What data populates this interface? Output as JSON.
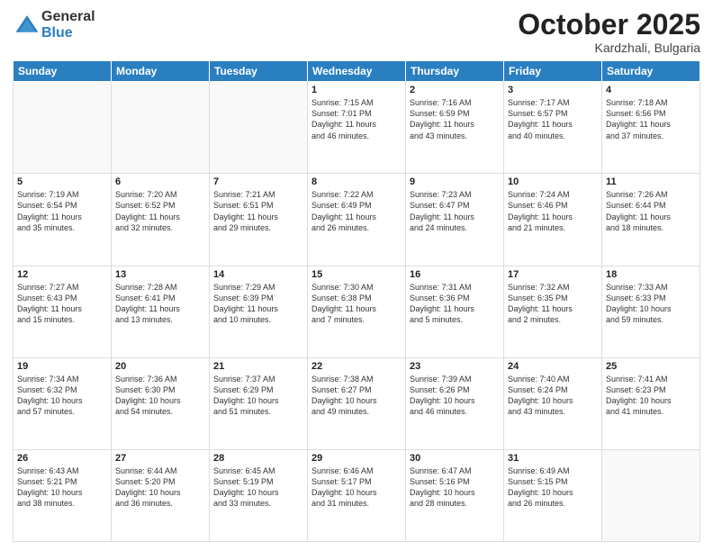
{
  "logo": {
    "general": "General",
    "blue": "Blue"
  },
  "header": {
    "month": "October 2025",
    "location": "Kardzhali, Bulgaria"
  },
  "weekdays": [
    "Sunday",
    "Monday",
    "Tuesday",
    "Wednesday",
    "Thursday",
    "Friday",
    "Saturday"
  ],
  "weeks": [
    [
      {
        "day": "",
        "info": ""
      },
      {
        "day": "",
        "info": ""
      },
      {
        "day": "",
        "info": ""
      },
      {
        "day": "1",
        "info": "Sunrise: 7:15 AM\nSunset: 7:01 PM\nDaylight: 11 hours\nand 46 minutes."
      },
      {
        "day": "2",
        "info": "Sunrise: 7:16 AM\nSunset: 6:59 PM\nDaylight: 11 hours\nand 43 minutes."
      },
      {
        "day": "3",
        "info": "Sunrise: 7:17 AM\nSunset: 6:57 PM\nDaylight: 11 hours\nand 40 minutes."
      },
      {
        "day": "4",
        "info": "Sunrise: 7:18 AM\nSunset: 6:56 PM\nDaylight: 11 hours\nand 37 minutes."
      }
    ],
    [
      {
        "day": "5",
        "info": "Sunrise: 7:19 AM\nSunset: 6:54 PM\nDaylight: 11 hours\nand 35 minutes."
      },
      {
        "day": "6",
        "info": "Sunrise: 7:20 AM\nSunset: 6:52 PM\nDaylight: 11 hours\nand 32 minutes."
      },
      {
        "day": "7",
        "info": "Sunrise: 7:21 AM\nSunset: 6:51 PM\nDaylight: 11 hours\nand 29 minutes."
      },
      {
        "day": "8",
        "info": "Sunrise: 7:22 AM\nSunset: 6:49 PM\nDaylight: 11 hours\nand 26 minutes."
      },
      {
        "day": "9",
        "info": "Sunrise: 7:23 AM\nSunset: 6:47 PM\nDaylight: 11 hours\nand 24 minutes."
      },
      {
        "day": "10",
        "info": "Sunrise: 7:24 AM\nSunset: 6:46 PM\nDaylight: 11 hours\nand 21 minutes."
      },
      {
        "day": "11",
        "info": "Sunrise: 7:26 AM\nSunset: 6:44 PM\nDaylight: 11 hours\nand 18 minutes."
      }
    ],
    [
      {
        "day": "12",
        "info": "Sunrise: 7:27 AM\nSunset: 6:43 PM\nDaylight: 11 hours\nand 15 minutes."
      },
      {
        "day": "13",
        "info": "Sunrise: 7:28 AM\nSunset: 6:41 PM\nDaylight: 11 hours\nand 13 minutes."
      },
      {
        "day": "14",
        "info": "Sunrise: 7:29 AM\nSunset: 6:39 PM\nDaylight: 11 hours\nand 10 minutes."
      },
      {
        "day": "15",
        "info": "Sunrise: 7:30 AM\nSunset: 6:38 PM\nDaylight: 11 hours\nand 7 minutes."
      },
      {
        "day": "16",
        "info": "Sunrise: 7:31 AM\nSunset: 6:36 PM\nDaylight: 11 hours\nand 5 minutes."
      },
      {
        "day": "17",
        "info": "Sunrise: 7:32 AM\nSunset: 6:35 PM\nDaylight: 11 hours\nand 2 minutes."
      },
      {
        "day": "18",
        "info": "Sunrise: 7:33 AM\nSunset: 6:33 PM\nDaylight: 10 hours\nand 59 minutes."
      }
    ],
    [
      {
        "day": "19",
        "info": "Sunrise: 7:34 AM\nSunset: 6:32 PM\nDaylight: 10 hours\nand 57 minutes."
      },
      {
        "day": "20",
        "info": "Sunrise: 7:36 AM\nSunset: 6:30 PM\nDaylight: 10 hours\nand 54 minutes."
      },
      {
        "day": "21",
        "info": "Sunrise: 7:37 AM\nSunset: 6:29 PM\nDaylight: 10 hours\nand 51 minutes."
      },
      {
        "day": "22",
        "info": "Sunrise: 7:38 AM\nSunset: 6:27 PM\nDaylight: 10 hours\nand 49 minutes."
      },
      {
        "day": "23",
        "info": "Sunrise: 7:39 AM\nSunset: 6:26 PM\nDaylight: 10 hours\nand 46 minutes."
      },
      {
        "day": "24",
        "info": "Sunrise: 7:40 AM\nSunset: 6:24 PM\nDaylight: 10 hours\nand 43 minutes."
      },
      {
        "day": "25",
        "info": "Sunrise: 7:41 AM\nSunset: 6:23 PM\nDaylight: 10 hours\nand 41 minutes."
      }
    ],
    [
      {
        "day": "26",
        "info": "Sunrise: 6:43 AM\nSunset: 5:21 PM\nDaylight: 10 hours\nand 38 minutes."
      },
      {
        "day": "27",
        "info": "Sunrise: 6:44 AM\nSunset: 5:20 PM\nDaylight: 10 hours\nand 36 minutes."
      },
      {
        "day": "28",
        "info": "Sunrise: 6:45 AM\nSunset: 5:19 PM\nDaylight: 10 hours\nand 33 minutes."
      },
      {
        "day": "29",
        "info": "Sunrise: 6:46 AM\nSunset: 5:17 PM\nDaylight: 10 hours\nand 31 minutes."
      },
      {
        "day": "30",
        "info": "Sunrise: 6:47 AM\nSunset: 5:16 PM\nDaylight: 10 hours\nand 28 minutes."
      },
      {
        "day": "31",
        "info": "Sunrise: 6:49 AM\nSunset: 5:15 PM\nDaylight: 10 hours\nand 26 minutes."
      },
      {
        "day": "",
        "info": ""
      }
    ]
  ]
}
